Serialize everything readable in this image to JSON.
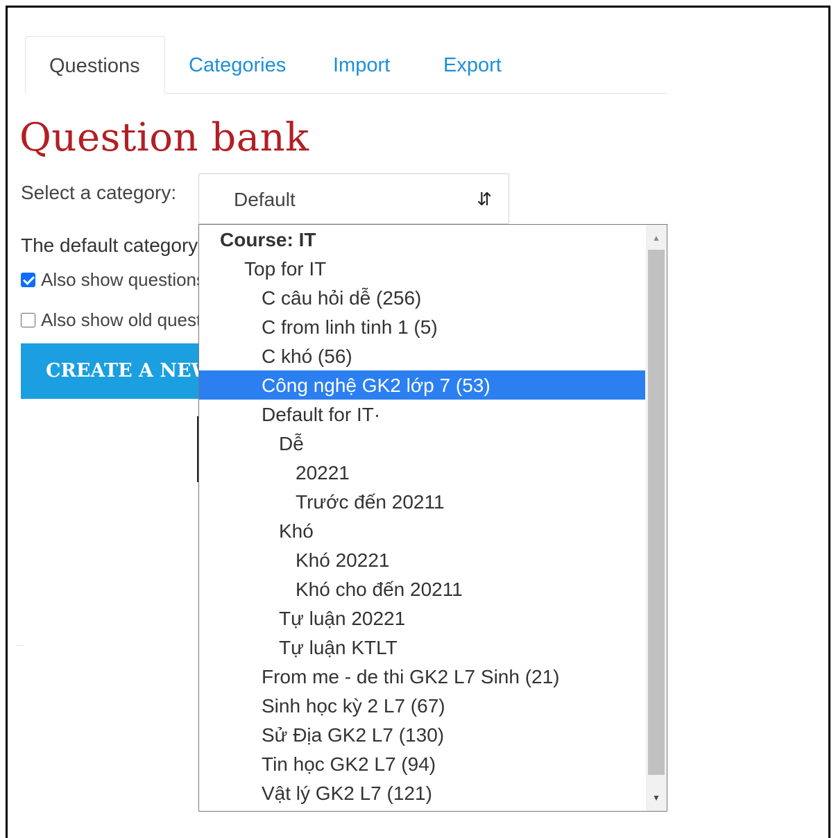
{
  "tabs": [
    {
      "label": "Questions",
      "active": true
    },
    {
      "label": "Categories",
      "active": false
    },
    {
      "label": "Import",
      "active": false
    },
    {
      "label": "Export",
      "active": false
    }
  ],
  "page_title": "Question bank",
  "category_select": {
    "label": "Select a category:",
    "value": "Default",
    "arrow_icon": "updown-arrows-icon"
  },
  "default_category_text": "The default category",
  "checkbox_show_subcategories": {
    "label": "Also show questions from subcategories",
    "checked": true
  },
  "checkbox_show_old": {
    "label": "Also show old questions",
    "checked": false
  },
  "create_button": "CREATE A NEW QUESTION",
  "dropdown": {
    "options": [
      {
        "label": "Course: IT",
        "type": "group"
      },
      {
        "label": "Top for IT",
        "level": 1
      },
      {
        "label": "C câu hỏi dễ (256)",
        "level": 2
      },
      {
        "label": "C from linh tinh 1 (5)",
        "level": 2
      },
      {
        "label": "C khó (56)",
        "level": 2
      },
      {
        "label": "Công nghệ GK2 lớp 7 (53)",
        "level": 2,
        "selected": true
      },
      {
        "label": "Default for IT·",
        "level": 2
      },
      {
        "label": "Dễ",
        "level": 3
      },
      {
        "label": "20221",
        "level": 4
      },
      {
        "label": "Trước đến 20211",
        "level": 4
      },
      {
        "label": "Khó",
        "level": 3
      },
      {
        "label": "Khó 20221",
        "level": 4
      },
      {
        "label": "Khó cho đến 20211",
        "level": 4
      },
      {
        "label": "Tự luận 20221",
        "level": 3
      },
      {
        "label": "Tự luận KTLT",
        "level": 3
      },
      {
        "label": "From me - de thi GK2 L7 Sinh (21)",
        "level": 2
      },
      {
        "label": "Sinh học kỳ 2 L7 (67)",
        "level": 2
      },
      {
        "label": "Sử Địa GK2 L7 (130)",
        "level": 2
      },
      {
        "label": "Tin học GK2 L7 (94)",
        "level": 2
      },
      {
        "label": "Vật lý GK2 L7 (121)",
        "level": 2
      }
    ],
    "selected_color": "#2b7ff0"
  },
  "colors": {
    "link": "#1d8fd6",
    "title": "#b11f24",
    "button": "#1b9fe0"
  }
}
